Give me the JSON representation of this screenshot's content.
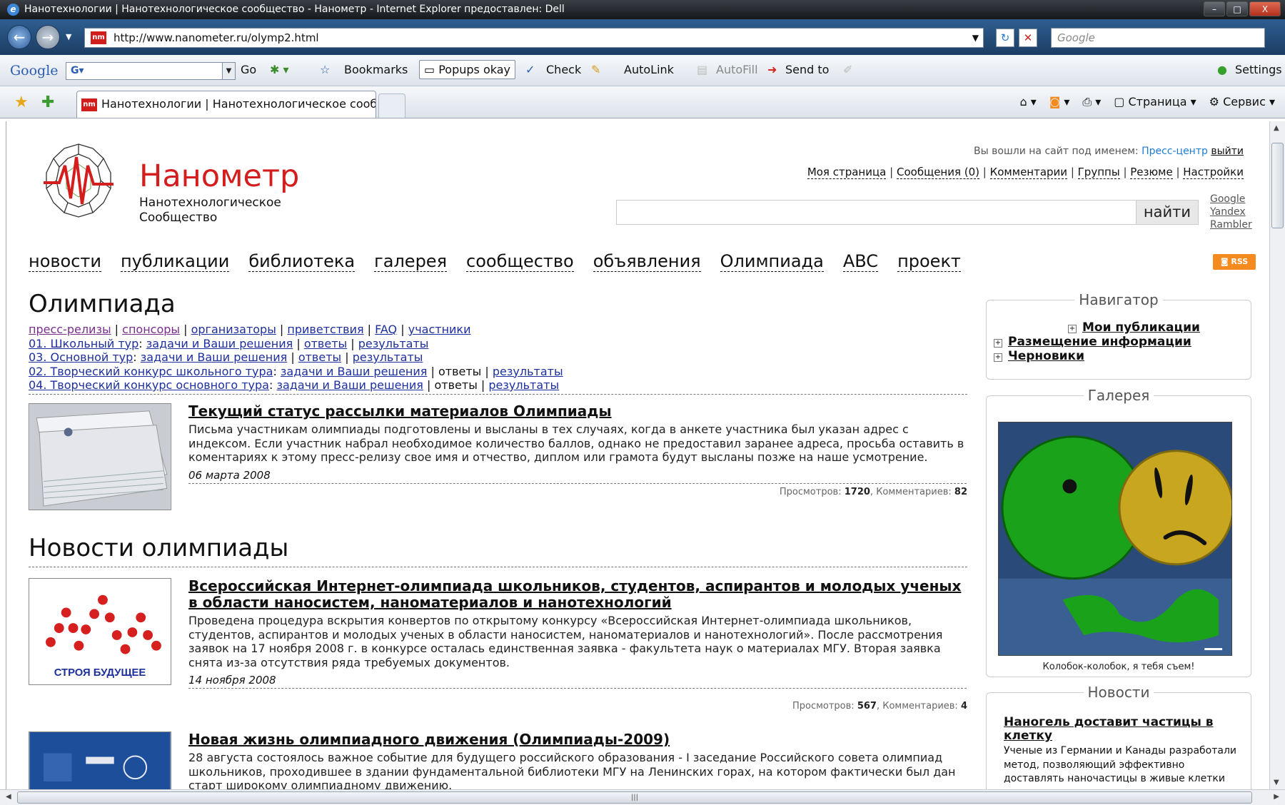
{
  "window": {
    "title": "Нанотехнологии | Нанотехнологическое сообщество - Нанометр - Internet Explorer предоставлен: Dell",
    "min": "–",
    "max": "□",
    "close": "X"
  },
  "address": {
    "url": "http://www.nanometer.ru/olymp2.html",
    "search_placeholder": "Google",
    "favicon": "nm"
  },
  "googlebar": {
    "logo": "Google",
    "g_letter": "G",
    "go": "Go",
    "bookmarks": "Bookmarks",
    "popups": "Popups okay",
    "check": "Check",
    "autolink": "AutoLink",
    "autofill": "AutoFill",
    "sendto": "Send to",
    "settings": "Settings"
  },
  "tabs": [
    {
      "label": "Нанотехнологии | Нанотехнологическое сооб..."
    }
  ],
  "commandbar": {
    "page": "Страница",
    "tools": "Сервис"
  },
  "site": {
    "brand": "Нанометр",
    "tagline": "Нанотехнологическое Сообщество",
    "logged_in_prefix": "Вы вошли на сайт под именем:",
    "username": "Пресс-центр",
    "logout": "выйти",
    "top_links": [
      "Моя страница",
      "Сообщения (0)",
      "Комментарии",
      "Группы",
      "Резюме",
      "Настройки"
    ],
    "search_button": "найти",
    "engines": [
      "Google",
      "Yandex",
      "Rambler"
    ],
    "nav": [
      "новости",
      "публикации",
      "библиотека",
      "галерея",
      "сообщество",
      "объявления",
      "Олимпиада",
      "ABC",
      "проект"
    ],
    "rss": "RSS"
  },
  "page": {
    "title": "Олимпиада",
    "row1": [
      "пресс-релизы",
      "спонсоры",
      "организаторы",
      "приветствия",
      "FAQ",
      "участники"
    ],
    "row2": {
      "head": "01. Школьный тур",
      "tasks": "задачи и Ваши решения",
      "answers": "ответы",
      "results": "результаты"
    },
    "row3": {
      "head": "03. Основной тур",
      "tasks": "задачи и Ваши решения",
      "answers": "ответы",
      "results": "результаты"
    },
    "row4": {
      "head": "02. Творческий конкурс школьного тура",
      "tasks": "задачи и Ваши решения",
      "answers": "ответы",
      "results": "результаты"
    },
    "row5": {
      "head": "04. Творческий конкурс основного тура",
      "tasks": "задачи и Ваши решения",
      "answers": "ответы",
      "results": "результаты"
    }
  },
  "featured": {
    "title": "Текущий статус рассылки материалов Олимпиады",
    "text": "Письма участникам олимпиады подготовлены и высланы в тех случаях, когда в анкете участника был указан адрес с индексом. Если участник набрал необходимое количество баллов, однако не предоставил заранее адреса, просьба оставить в коментариях к этому пресс-релизу свое имя и отчество, диплом или грамота будут высланы позже на наше усмотрение.",
    "date": "06 марта 2008",
    "views_label": "Просмотров:",
    "views": "1720",
    "comments_label": "Комментариев:",
    "comments": "82"
  },
  "news_heading": "Новости олимпиады",
  "news": [
    {
      "title": "Всероссийская Интернет-олимпиада школьников, студентов, аспирантов и молодых ученых в области наносистем, наноматериалов и нанотехнологий",
      "text": "Проведена процедура вскрытия конвертов по открытому конкурсу «Всероссийская Интернет-олимпиада школьников, студентов, аспирантов и молодых ученых в области наносистем, наноматериалов и нанотехнологий». После рассмотрения заявок на 17 ноября 2008 г. в конкурсе осталась единственная заявка - факультета наук о материалах МГУ. Вторая заявка снята из-за отсутствия ряда требуемых документов.",
      "date": "14 ноября 2008",
      "views_label": "Просмотров:",
      "views": "567",
      "comments_label": "Комментариев:",
      "comments": "4",
      "thumb_caption": "СТРОЯ БУДУЩЕЕ"
    },
    {
      "title": "Новая жизнь олимпиадного движения (Олимпиады-2009)",
      "text": "28 августа состоялось важное событие для будущего российского образования - I заседание Российского совета олимпиад школьников, проходившее в здании фундаментальной библиотеки МГУ на Ленинских горах, на котором фактически был дан старт широкому олимпиадному движению."
    }
  ],
  "sidebar": {
    "navigator_title": "Навигатор",
    "navigator_items": [
      "Мои публикации",
      "Размещение информации",
      "Черновики"
    ],
    "gallery_title": "Галерея",
    "gallery_caption": "Колобок-колобок, я тебя съем!",
    "news_title": "Новости",
    "news_item_title": "Наногель доставит частицы в клетку",
    "news_item_text": "Ученые из Германии и Канады разработали метод, позволяющий эффективно доставлять наночастицы в живые клетки при помощи"
  }
}
